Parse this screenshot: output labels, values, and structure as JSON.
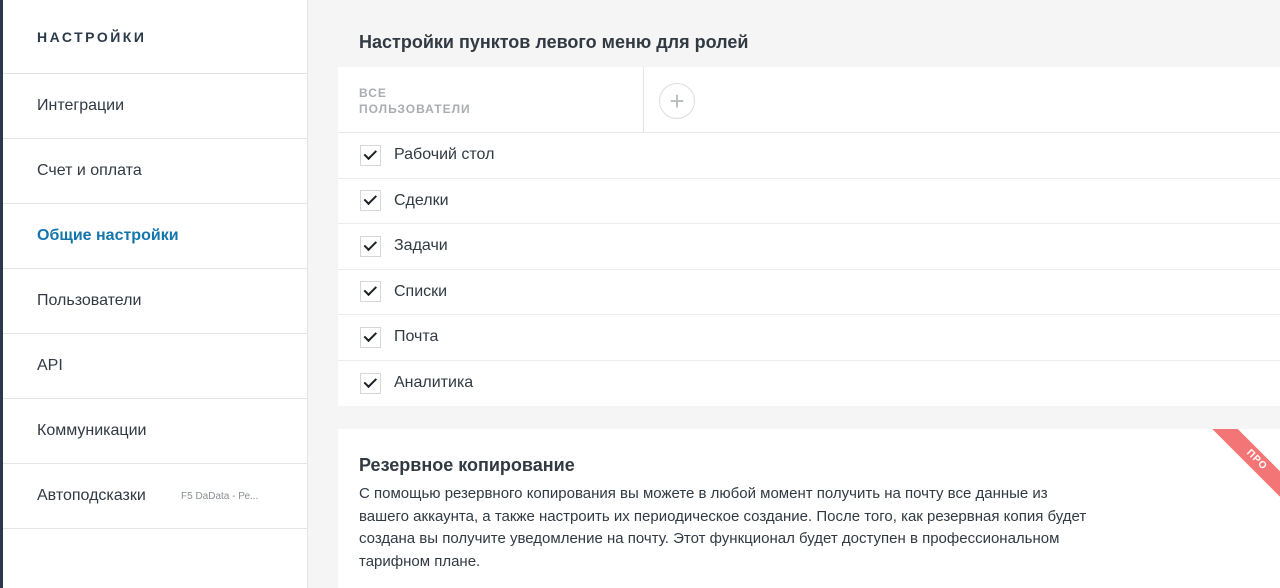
{
  "sidebar": {
    "title": "НАСТРОЙКИ",
    "items": [
      {
        "label": "Интеграции",
        "active": false
      },
      {
        "label": "Счет и оплата",
        "active": false
      },
      {
        "label": "Общие настройки",
        "active": true
      },
      {
        "label": "Пользователи",
        "active": false
      },
      {
        "label": "API",
        "active": false
      },
      {
        "label": "Коммуникации",
        "active": false
      },
      {
        "label": "Автоподсказки",
        "sub": "F5 DaData - Ре...",
        "active": false
      }
    ]
  },
  "main": {
    "menu_section": {
      "title": "Настройки пунктов левого меню для ролей",
      "role_tab": "ВСЕ ПОЛЬЗОВАТЕЛИ",
      "add_role_symbol": "+",
      "items": [
        {
          "label": "Рабочий стол",
          "checked": true
        },
        {
          "label": "Сделки",
          "checked": true
        },
        {
          "label": "Задачи",
          "checked": true
        },
        {
          "label": "Списки",
          "checked": true
        },
        {
          "label": "Почта",
          "checked": true
        },
        {
          "label": "Аналитика",
          "checked": true
        }
      ]
    },
    "backup_section": {
      "title": "Резервное копирование",
      "description": "С помощью резервного копирования вы можете в любой момент получить на почту все данные из вашего аккаунта, а также настроить их периодическое создание. После того, как резервная копия будет создана вы получите уведомление на почту. Этот функционал будет доступен в профессиональном тарифном плане.",
      "ribbon": "ПРО"
    }
  },
  "colors": {
    "accent": "#1375ab",
    "sidebar_edge": "#2b3a4a",
    "ribbon": "#f37575"
  }
}
